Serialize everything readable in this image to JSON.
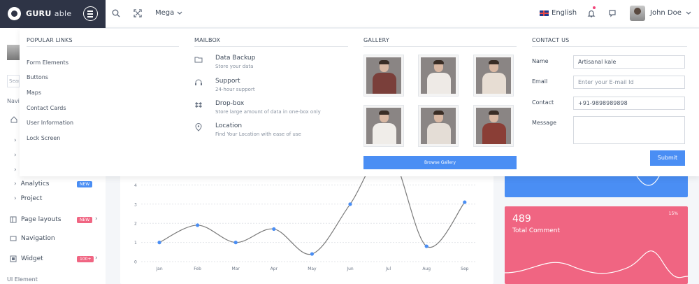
{
  "brand": {
    "name": "GURU",
    "suffix": "able"
  },
  "header": {
    "mega_label": "Mega",
    "language": "English",
    "user_name": "John Doe"
  },
  "sidebar": {
    "search_placeholder": "Sear",
    "nav_label": "Navi",
    "items": [
      {
        "label": "Analytics",
        "badge": "NEW"
      },
      {
        "label": "Project"
      },
      {
        "label": "Page layouts",
        "badge": "NEW"
      },
      {
        "label": "Navigation"
      },
      {
        "label": "Widget",
        "badge": "100+"
      }
    ],
    "group_label": "UI Element"
  },
  "mega_menu": {
    "popular": {
      "title": "POPULAR LINKS",
      "links": [
        "Form Elements",
        "Buttons",
        "Maps",
        "Contact Cards",
        "User Information",
        "Lock Screen"
      ]
    },
    "mailbox": {
      "title": "MAILBOX",
      "items": [
        {
          "icon": "folder-icon",
          "title": "Data Backup",
          "desc": "Store your data"
        },
        {
          "icon": "headset-icon",
          "title": "Support",
          "desc": "24-hour support"
        },
        {
          "icon": "dropbox-icon",
          "title": "Drop-box",
          "desc": "Store large amount of data in one-box only"
        },
        {
          "icon": "location-pin-icon",
          "title": "Location",
          "desc": "Find Your Location with ease of use"
        }
      ]
    },
    "gallery": {
      "title": "GALLERY",
      "button_label": "Browse Gallery"
    },
    "contact": {
      "title": "CONTACT US",
      "name_label": "Name",
      "name_value": "Artisanal kale",
      "email_label": "Email",
      "email_placeholder": "Enter your E-mail Id",
      "contact_label": "Contact",
      "contact_value": "+91-9898989898",
      "message_label": "Message",
      "submit_label": "Submit"
    }
  },
  "stat_card": {
    "value": "489",
    "label": "Total Comment",
    "percent": "15%",
    "color": "#f06582"
  },
  "accent_color": "#4a8ef4",
  "chart_data": {
    "type": "line",
    "categories": [
      "Jan",
      "Feb",
      "Mar",
      "Apr",
      "May",
      "Jun",
      "Jul",
      "Aug",
      "Sep"
    ],
    "values": [
      1,
      1.9,
      1,
      1.7,
      0.4,
      3,
      5.8,
      0.8,
      3.1
    ],
    "yticks": [
      0,
      1,
      2,
      3,
      4
    ],
    "ylim": [
      0,
      4.3
    ]
  }
}
